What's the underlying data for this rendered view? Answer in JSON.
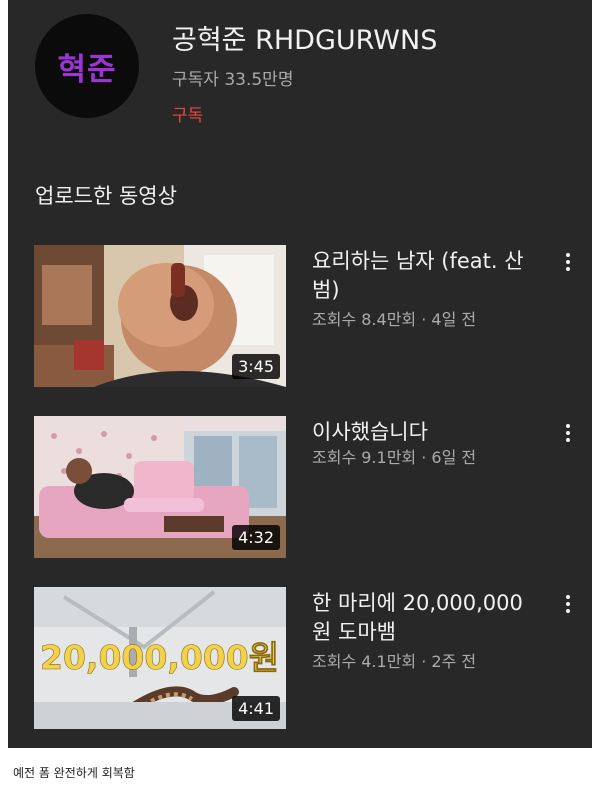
{
  "channel": {
    "avatar_text": "혁준",
    "name": "공혁준 RHDGURWNS",
    "subscribers": "구독자 33.5만명",
    "subscribe_label": "구독"
  },
  "section_title": "업로드한 동영상",
  "videos": [
    {
      "title": "요리하는 남자 (feat. 산범)",
      "meta": "조회수 8.4만회 · 4일 전",
      "duration": "3:45",
      "thumbnail_icon": "man-eating-thumbnail"
    },
    {
      "title": "이사했습니다",
      "meta": "조회수 9.1만회 · 6일 전",
      "duration": "4:32",
      "thumbnail_icon": "man-on-pink-sofa-thumbnail"
    },
    {
      "title": "한 마리에 20,000,000원 도마뱀",
      "meta": "조회수 4.1만회 · 2주 전",
      "duration": "4:41",
      "thumbnail_icon": "lizard-thumbnail",
      "thumbnail_text": "20,000,000원"
    }
  ],
  "caption": "예전 폼 완전하게 회복함",
  "colors": {
    "background": "#282828",
    "subscribe": "#e8473b",
    "avatar_text": "#9b35d6",
    "thumbnail_text": "#f2d24a"
  }
}
